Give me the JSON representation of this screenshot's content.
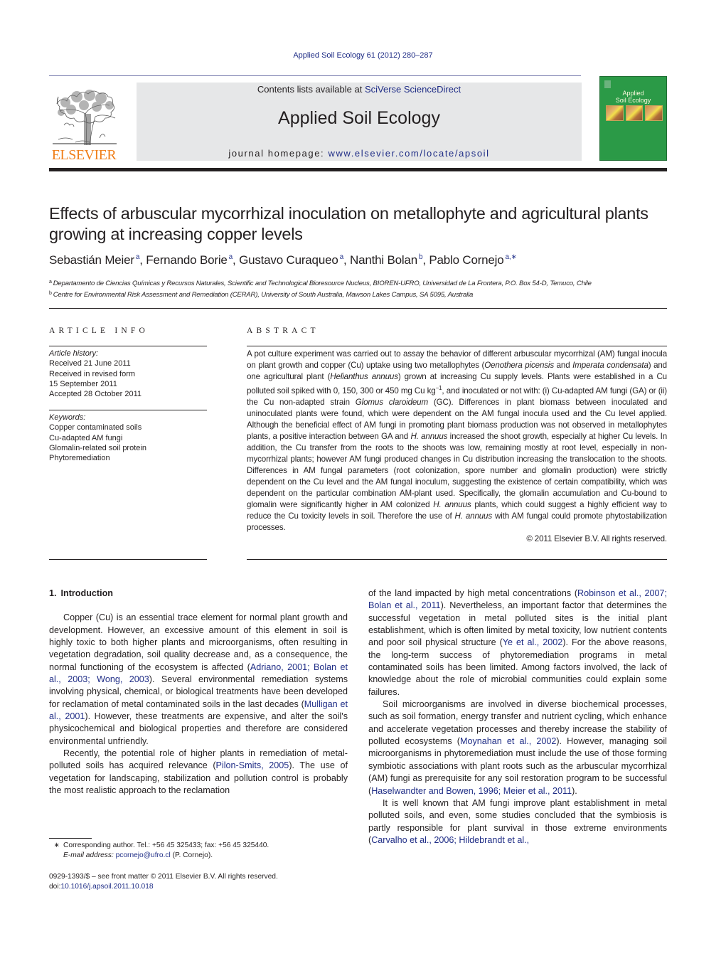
{
  "header": {
    "citation": "Applied Soil Ecology 61 (2012) 280–287",
    "contents_prefix": "Contents lists available at ",
    "contents_link": "SciVerse ScienceDirect",
    "journal_title": "Applied Soil Ecology",
    "homepage_prefix": "journal homepage: ",
    "homepage_url": "www.elsevier.com/locate/apsoil",
    "publisher_logo_text": "ELSEVIER",
    "cover_title_line1": "Applied",
    "cover_title_line2": "Soil Ecology"
  },
  "colors": {
    "link": "#1f2d86",
    "elsevier_orange": "#f07f1a",
    "cover_green": "#2b9a47",
    "masthead_gray": "#e6e7e8"
  },
  "article": {
    "title": "Effects of arbuscular mycorrhizal inoculation on metallophyte and agricultural plants growing at increasing copper levels",
    "authors": [
      {
        "name": "Sebastián Meier",
        "affil": "a"
      },
      {
        "name": "Fernando Borie",
        "affil": "a"
      },
      {
        "name": "Gustavo Curaqueo",
        "affil": "a"
      },
      {
        "name": "Nanthi Bolan",
        "affil": "b"
      },
      {
        "name": "Pablo Cornejo",
        "affil": "a,∗"
      }
    ],
    "affiliations": [
      {
        "key": "a",
        "text": "Departamento de Ciencias Químicas y Recursos Naturales, Scientific and Technological Bioresource Nucleus, BIOREN-UFRO, Universidad de La Frontera, P.O. Box 54-D, Temuco, Chile"
      },
      {
        "key": "b",
        "text": "Centre for Environmental Risk Assessment and Remediation (CERAR), University of South Australia, Mawson Lakes Campus, SA 5095, Australia"
      }
    ]
  },
  "article_info": {
    "heading": "ARTICLE INFO",
    "history_label": "Article history:",
    "history": [
      "Received 21 June 2011",
      "Received in revised form",
      "15 September 2011",
      "Accepted 28 October 2011"
    ],
    "keywords_label": "Keywords:",
    "keywords": [
      "Copper contaminated soils",
      "Cu-adapted AM fungi",
      "Glomalin-related soil protein",
      "Phytoremediation"
    ]
  },
  "abstract": {
    "heading": "ABSTRACT",
    "parts": [
      "A pot culture experiment was carried out to assay the behavior of different arbuscular mycorrhizal (AM) fungal inocula on plant growth and copper (Cu) uptake using two metallophytes (",
      "Oenothera picensis",
      " and ",
      "Imperata condensata",
      ") and one agricultural plant (",
      "Helianthus annuus",
      ") grown at increasing Cu supply levels. Plants were established in a Cu polluted soil spiked with 0, 150, 300 or 450 mg Cu kg",
      "−1",
      ", and inoculated or not with: (i) Cu-adapted AM fungi (GA) or (ii) the Cu non-adapted strain ",
      "Glomus claroideum",
      " (GC). Differences in plant biomass between inoculated and uninoculated plants were found, which were dependent on the AM fungal inocula used and the Cu level applied. Although the beneficial effect of AM fungi in promoting plant biomass production was not observed in metallophytes plants, a positive interaction between GA and ",
      "H. annuus",
      " increased the shoot growth, especially at higher Cu levels. In addition, the Cu transfer from the roots to the shoots was low, remaining mostly at root level, especially in non-mycorrhizal plants; however AM fungi produced changes in Cu distribution increasing the translocation to the shoots. Differences in AM fungal parameters (root colonization, spore number and glomalin production) were strictly dependent on the Cu level and the AM fungal inoculum, suggesting the existence of certain compatibility, which was dependent on the particular combination AM-plant used. Specifically, the glomalin accumulation and Cu-bound to glomalin were significantly higher in AM colonized ",
      "H. annuus",
      " plants, which could suggest a highly efficient way to reduce the Cu toxicity levels in soil. Therefore the use of ",
      "H. annuus",
      " with AM fungal could promote phytostabilization processes."
    ],
    "copyright": "© 2011 Elsevier B.V. All rights reserved."
  },
  "body": {
    "section_number": "1.",
    "section_title": "Introduction",
    "left": {
      "p1": [
        "Copper (Cu) is an essential trace element for normal plant growth and development. However, an excessive amount of this element in soil is highly toxic to both higher plants and microorganisms, often resulting in vegetation degradation, soil quality decrease and, as a consequence, the normal functioning of the ecosystem is affected (",
        "Adriano, 2001; Bolan et al., 2003; Wong, 2003",
        "). Several environmental remediation systems involving physical, chemical, or biological treatments have been developed for reclamation of metal contaminated soils in the last decades (",
        "Mulligan et al., 2001",
        "). However, these treatments are expensive, and alter the soil's physicochemical and biological properties and therefore are considered environmental unfriendly."
      ],
      "p2": [
        "Recently, the potential role of higher plants in remediation of metal-polluted soils has acquired relevance (",
        "Pilon-Smits, 2005",
        "). The use of vegetation for landscaping, stabilization and pollution control is probably the most realistic approach to the reclamation"
      ]
    },
    "right": {
      "p1": [
        "of the land impacted by high metal concentrations (",
        "Robinson et al., 2007; Bolan et al., 2011",
        "). Nevertheless, an important factor that determines the successful vegetation in metal polluted sites is the initial plant establishment, which is often limited by metal toxicity, low nutrient contents and poor soil physical structure (",
        "Ye et al., 2002",
        "). For the above reasons, the long-term success of phytoremediation programs in metal contaminated soils has been limited. Among factors involved, the lack of knowledge about the role of microbial communities could explain some failures."
      ],
      "p2": [
        "Soil microorganisms are involved in diverse biochemical processes, such as soil formation, energy transfer and nutrient cycling, which enhance and accelerate vegetation processes and thereby increase the stability of polluted ecosystems (",
        "Moynahan et al., 2002",
        "). However, managing soil microorganisms in phytoremediation must include the use of those forming symbiotic associations with plant roots such as the arbuscular mycorrhizal (AM) fungi as prerequisite for any soil restoration program to be successful (",
        "Haselwandter and Bowen, 1996; Meier et al., 2011",
        ")."
      ],
      "p3": [
        "It is well known that AM fungi improve plant establishment in metal polluted soils, and even, some studies concluded that the symbiosis is partly responsible for plant survival in those extreme environments (",
        "Carvalho et al., 2006; Hildebrandt et al.,"
      ]
    }
  },
  "footnotes": {
    "star": "∗",
    "corresponding": "Corresponding author. Tel.: +56 45 325433; fax: +56 45 325440.",
    "email_label": "E-mail address:",
    "email": "pcornejo@ufro.cl",
    "email_suffix": " (P. Cornejo).",
    "front_matter": "0929-1393/$ – see front matter © 2011 Elsevier B.V. All rights reserved.",
    "doi_prefix": "doi:",
    "doi": "10.1016/j.apsoil.2011.10.018"
  }
}
